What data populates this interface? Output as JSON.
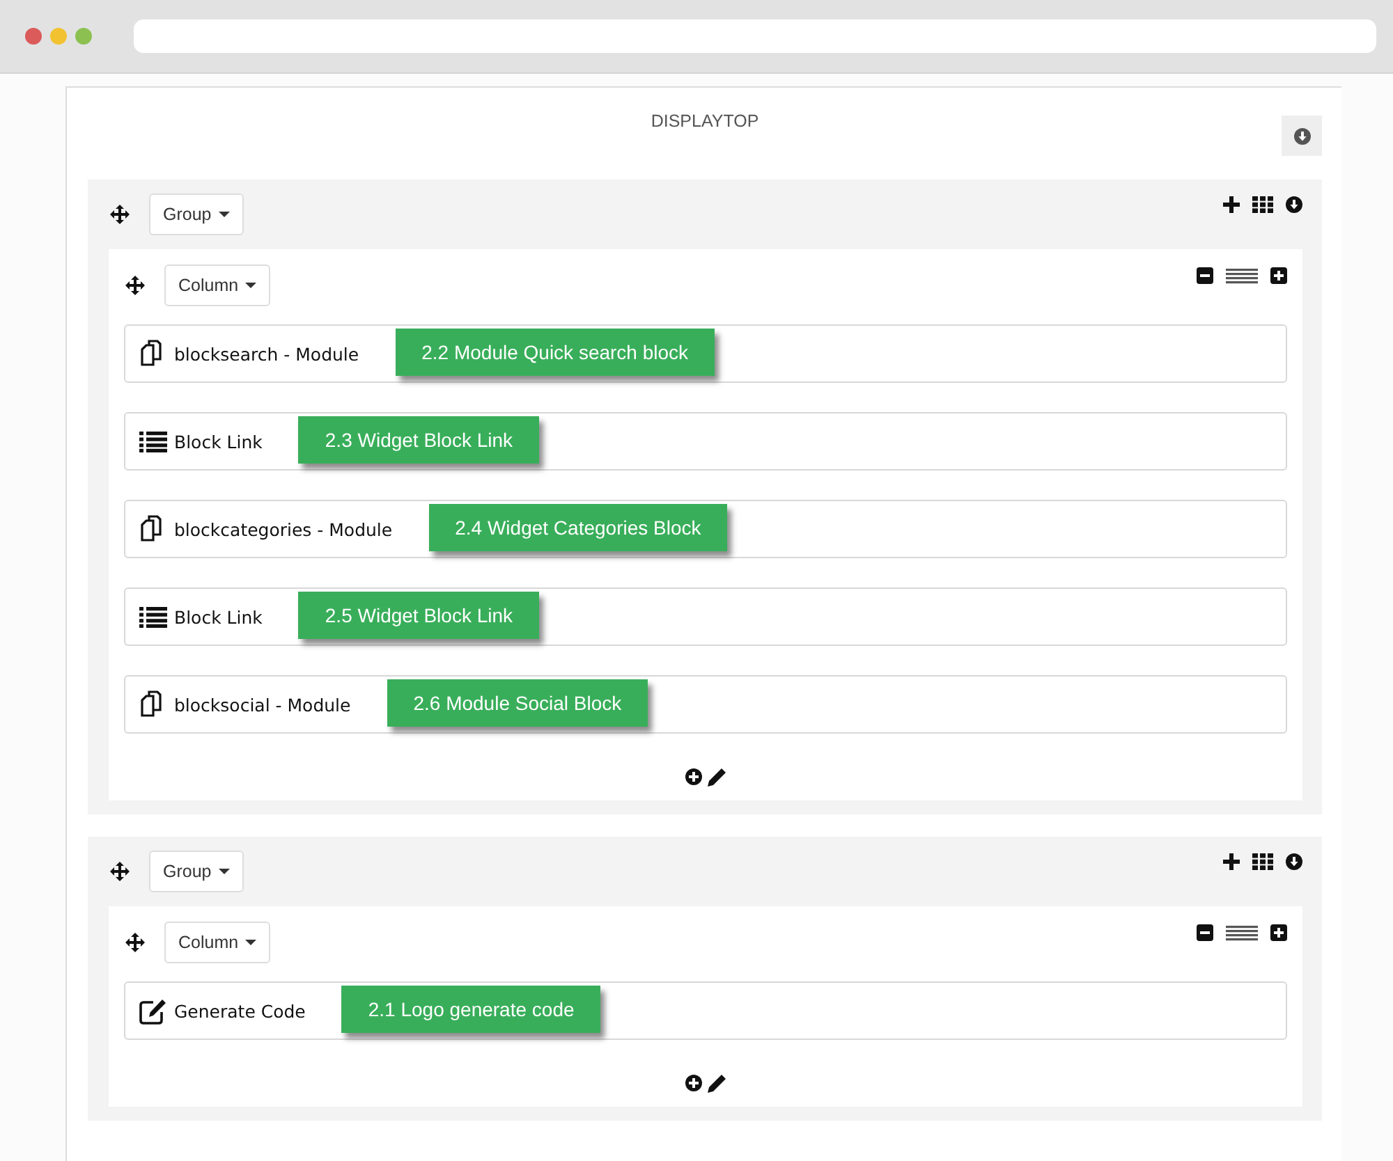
{
  "title": "DISPLAYTOP",
  "groups": [
    {
      "label": "Group",
      "columns": [
        {
          "label": "Column",
          "items": [
            {
              "kind": "module",
              "label": "blocksearch - Module",
              "callout": "2.2 Module Quick search block"
            },
            {
              "kind": "widget",
              "label": "Block Link",
              "callout": "2.3 Widget Block Link"
            },
            {
              "kind": "module",
              "label": "blockcategories - Module",
              "callout": "2.4 Widget Categories Block"
            },
            {
              "kind": "widget",
              "label": "Block Link",
              "callout": "2.5 Widget Block Link"
            },
            {
              "kind": "module",
              "label": "blocksocial - Module",
              "callout": "2.6 Module Social Block"
            }
          ]
        }
      ]
    },
    {
      "label": "Group",
      "columns": [
        {
          "label": "Column",
          "items": [
            {
              "kind": "code",
              "label": "Generate Code",
              "callout": "2.1 Logo generate code"
            }
          ]
        }
      ]
    }
  ]
}
